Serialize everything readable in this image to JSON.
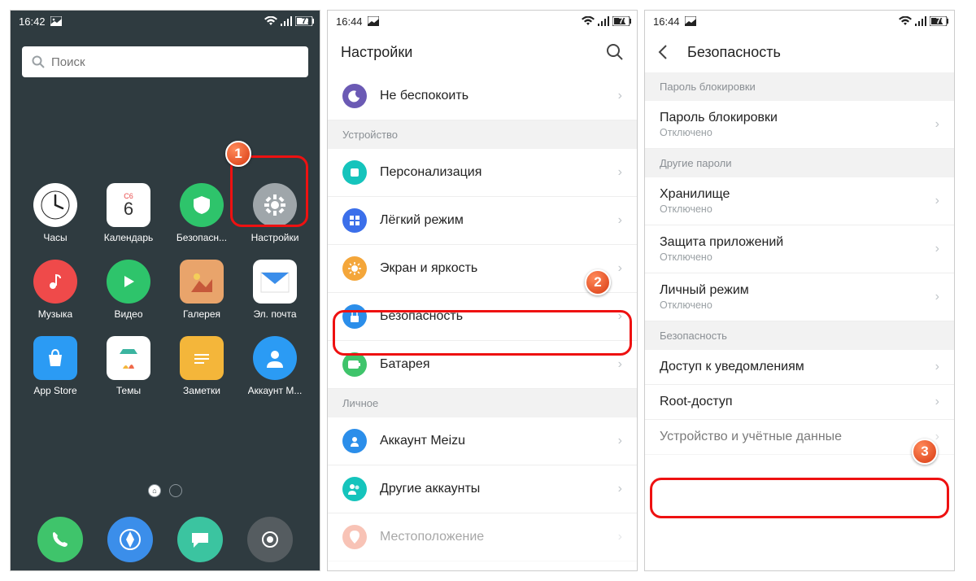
{
  "phone1": {
    "status": {
      "time": "16:42",
      "battery": "77"
    },
    "search_placeholder": "Поиск",
    "calendar": {
      "day_label": "C6",
      "day_num": "6"
    },
    "apps": [
      {
        "name": "Часы"
      },
      {
        "name": "Календарь"
      },
      {
        "name": "Безопасн..."
      },
      {
        "name": "Настройки"
      },
      {
        "name": "Музыка"
      },
      {
        "name": "Видео"
      },
      {
        "name": "Галерея"
      },
      {
        "name": "Эл. почта"
      },
      {
        "name": "App Store"
      },
      {
        "name": "Темы"
      },
      {
        "name": "Заметки"
      },
      {
        "name": "Аккаунт M..."
      }
    ]
  },
  "phone2": {
    "status": {
      "time": "16:44",
      "battery": "76"
    },
    "title": "Настройки",
    "items": {
      "dnd": "Не беспокоить",
      "sec_device": "Устройство",
      "personalization": "Персонализация",
      "easy_mode": "Лёгкий режим",
      "display": "Экран и яркость",
      "security": "Безопасность",
      "battery": "Батарея",
      "sec_personal": "Личное",
      "account_meizu": "Аккаунт Meizu",
      "other_accounts": "Другие аккаунты",
      "location": "Местоположение"
    }
  },
  "phone3": {
    "status": {
      "time": "16:44",
      "battery": "76"
    },
    "title": "Безопасность",
    "sec1": "Пароль блокировки",
    "lock_pw": {
      "label": "Пароль блокировки",
      "sub": "Отключено"
    },
    "sec2": "Другие пароли",
    "storage": {
      "label": "Хранилище",
      "sub": "Отключено"
    },
    "app_protect": {
      "label": "Защита приложений",
      "sub": "Отключено"
    },
    "private_mode": {
      "label": "Личный режим",
      "sub": "Отключено"
    },
    "sec3": "Безопасность",
    "notif_access": "Доступ к уведомлениям",
    "root": "Root-доступ",
    "device_creds": "Устройство и учётные данные"
  },
  "badges": {
    "b1": "1",
    "b2": "2",
    "b3": "3"
  }
}
